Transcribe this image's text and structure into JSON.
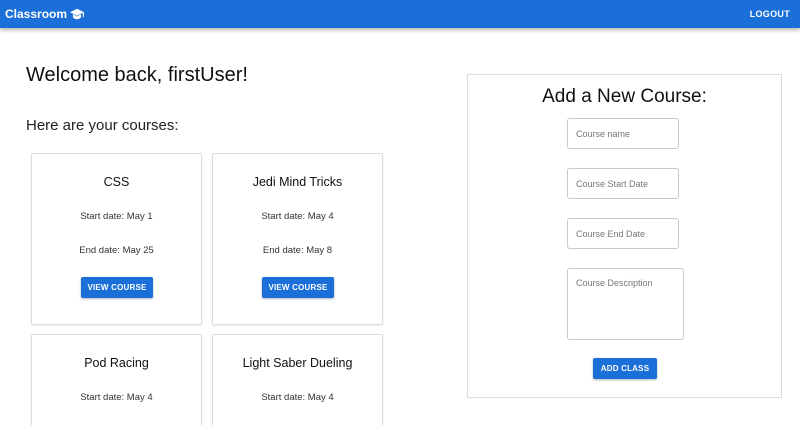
{
  "appbar": {
    "title": "Classroom",
    "logout_label": "LOGOUT"
  },
  "greeting": "Welcome back, firstUser!",
  "subheading": "Here are your courses:",
  "courses": [
    {
      "name": "CSS",
      "start": "Start date: May 1",
      "end": "End date: May 25",
      "button": "VIEW COURSE"
    },
    {
      "name": "Jedi Mind Tricks",
      "start": "Start date: May 4",
      "end": "End date: May 8",
      "button": "VIEW COURSE"
    },
    {
      "name": "Pod Racing",
      "start": "Start date: May 4"
    },
    {
      "name": "Light Saber Dueling",
      "start": "Start date: May 4"
    }
  ],
  "form": {
    "title": "Add a New Course:",
    "name_placeholder": "Course name",
    "start_placeholder": "Course Start Date",
    "end_placeholder": "Course End Date",
    "description_placeholder": "Course Description",
    "submit_label": "ADD CLASS"
  },
  "colors": {
    "primary": "#1a6fd8"
  },
  "icons": {
    "brand": "graduation-cap-icon"
  }
}
